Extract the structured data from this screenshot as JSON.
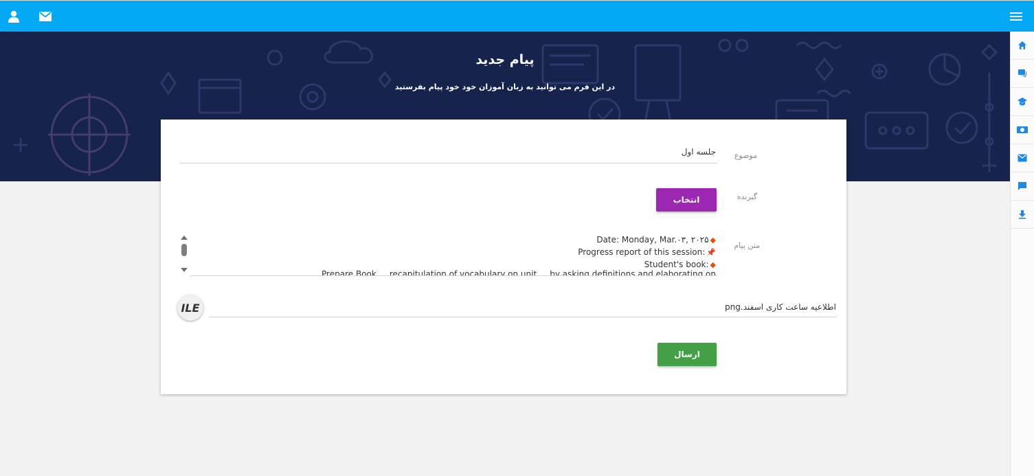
{
  "topbar": {
    "user_icon": "user-icon",
    "mail_icon": "mail-icon",
    "menu_icon": "menu-icon",
    "color": "#03a9f4"
  },
  "hero": {
    "title": "پیام جدید",
    "subtitle": "در این فرم می توانید به زبان آموزان خود خود پیام بفرستید",
    "background": "#16234c"
  },
  "sidebar": {
    "items": [
      {
        "icon": "home-icon"
      },
      {
        "icon": "chat-bubbles-icon"
      },
      {
        "icon": "graduation-cap-icon"
      },
      {
        "icon": "money-icon"
      },
      {
        "icon": "mail-icon"
      },
      {
        "icon": "comment-icon"
      },
      {
        "icon": "download-icon"
      }
    ]
  },
  "form": {
    "subject_label": "موضوع",
    "subject_value": "جلسه اول",
    "recipient_label": "گیرنده",
    "select_button": "انتخاب",
    "message_label": "متن پیام",
    "message_lines": [
      {
        "emoji": "◆",
        "text": "Date: Monday, Mar.۰۳, ۲۰۲۵"
      },
      {
        "emoji": "📌",
        "text": "Progress report of this session:"
      },
      {
        "emoji": "◆",
        "text": "Student's book:"
      },
      {
        "emoji": "",
        "text": "Prepare Book ... recapitulation of vocabulary on unit ... by asking definitions and elaborating on"
      }
    ],
    "file_icon_text": "ILE",
    "file_name": "اطلاعیه ساعت کاری اسفند.png",
    "send_button": "ارسال",
    "select_color": "#9c27b0",
    "send_color": "#43a047"
  }
}
